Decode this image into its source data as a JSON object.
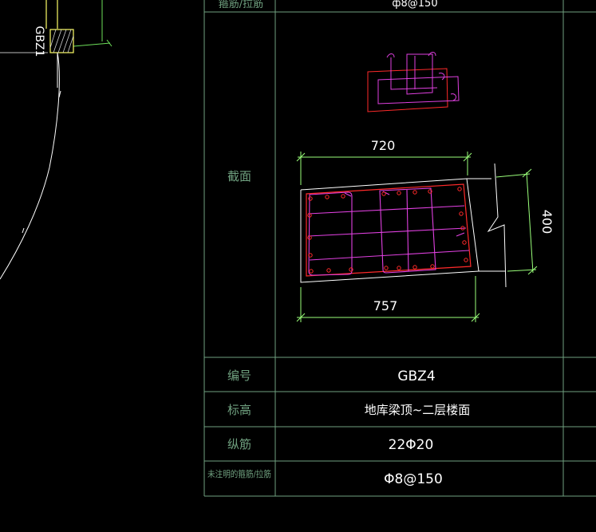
{
  "top_row": {
    "label": "箍筋/拉筋",
    "value": "ф8@150"
  },
  "section": {
    "label": "截面",
    "dim_top": "720",
    "dim_bottom": "757",
    "dim_right": "400"
  },
  "left_tag": "GBZ1",
  "rows": [
    {
      "label": "编号",
      "value": "GBZ4"
    },
    {
      "label": "标高",
      "value": "地库梁顶~二层楼面"
    },
    {
      "label": "纵筋",
      "value": "22Φ20"
    },
    {
      "label": "未注明的箍筋/拉筋",
      "value": "Φ8@150"
    }
  ],
  "colors": {
    "table_line": "#6fa07f",
    "dimension": "#9aff7a",
    "outline": "#ffffff",
    "hoop": "#ff2a2a",
    "tie": "#e040e0",
    "highlight": "#ffff66",
    "dark_blue": "#2a2aa0"
  }
}
